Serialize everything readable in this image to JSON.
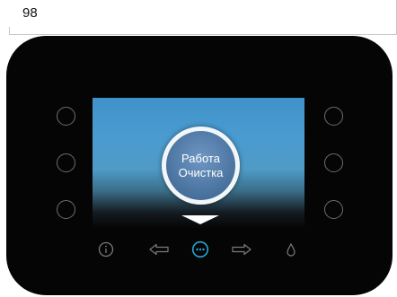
{
  "page": {
    "number": "98"
  },
  "screen": {
    "main_button": {
      "line1": "Работа",
      "line2": "Очистка"
    }
  },
  "nav": {
    "icons": [
      "info-icon",
      "arrow-left-icon",
      "more-icon",
      "arrow-right-icon",
      "drop-icon"
    ]
  },
  "colors": {
    "device": "#050505",
    "screen_top": "#3f92c9",
    "accent": "#25a8d0",
    "button_fill": "#4a73a0"
  }
}
